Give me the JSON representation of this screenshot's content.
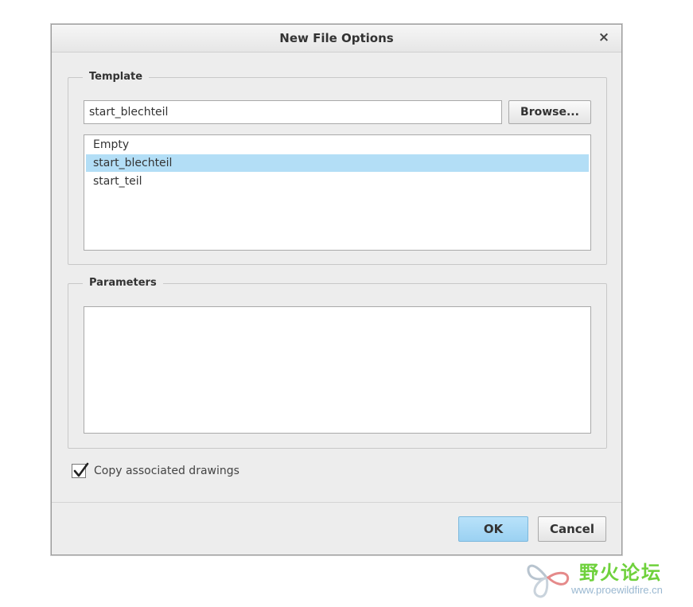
{
  "dialog": {
    "title": "New File Options",
    "close_glyph": "×"
  },
  "template": {
    "legend": "Template",
    "input_value": "start_blechteil",
    "browse_label": "Browse...",
    "list_items": [
      "Empty",
      "start_blechteil",
      "start_teil"
    ],
    "selected_index": 1
  },
  "parameters": {
    "legend": "Parameters"
  },
  "copy_drawings": {
    "label": "Copy associated drawings",
    "checked": true
  },
  "buttons": {
    "ok_label": "OK",
    "cancel_label": "Cancel"
  },
  "watermark": {
    "title": "野火论坛",
    "url": "www.proewildfire.cn"
  },
  "colors": {
    "selection": "#b3def6",
    "ok_button": "#9bd1f2",
    "watermark_green": "#6fd13c"
  },
  "icons": {
    "close": "close-icon",
    "check": "checkmark-icon",
    "watermark_logo": "butterfly-logo-icon"
  }
}
